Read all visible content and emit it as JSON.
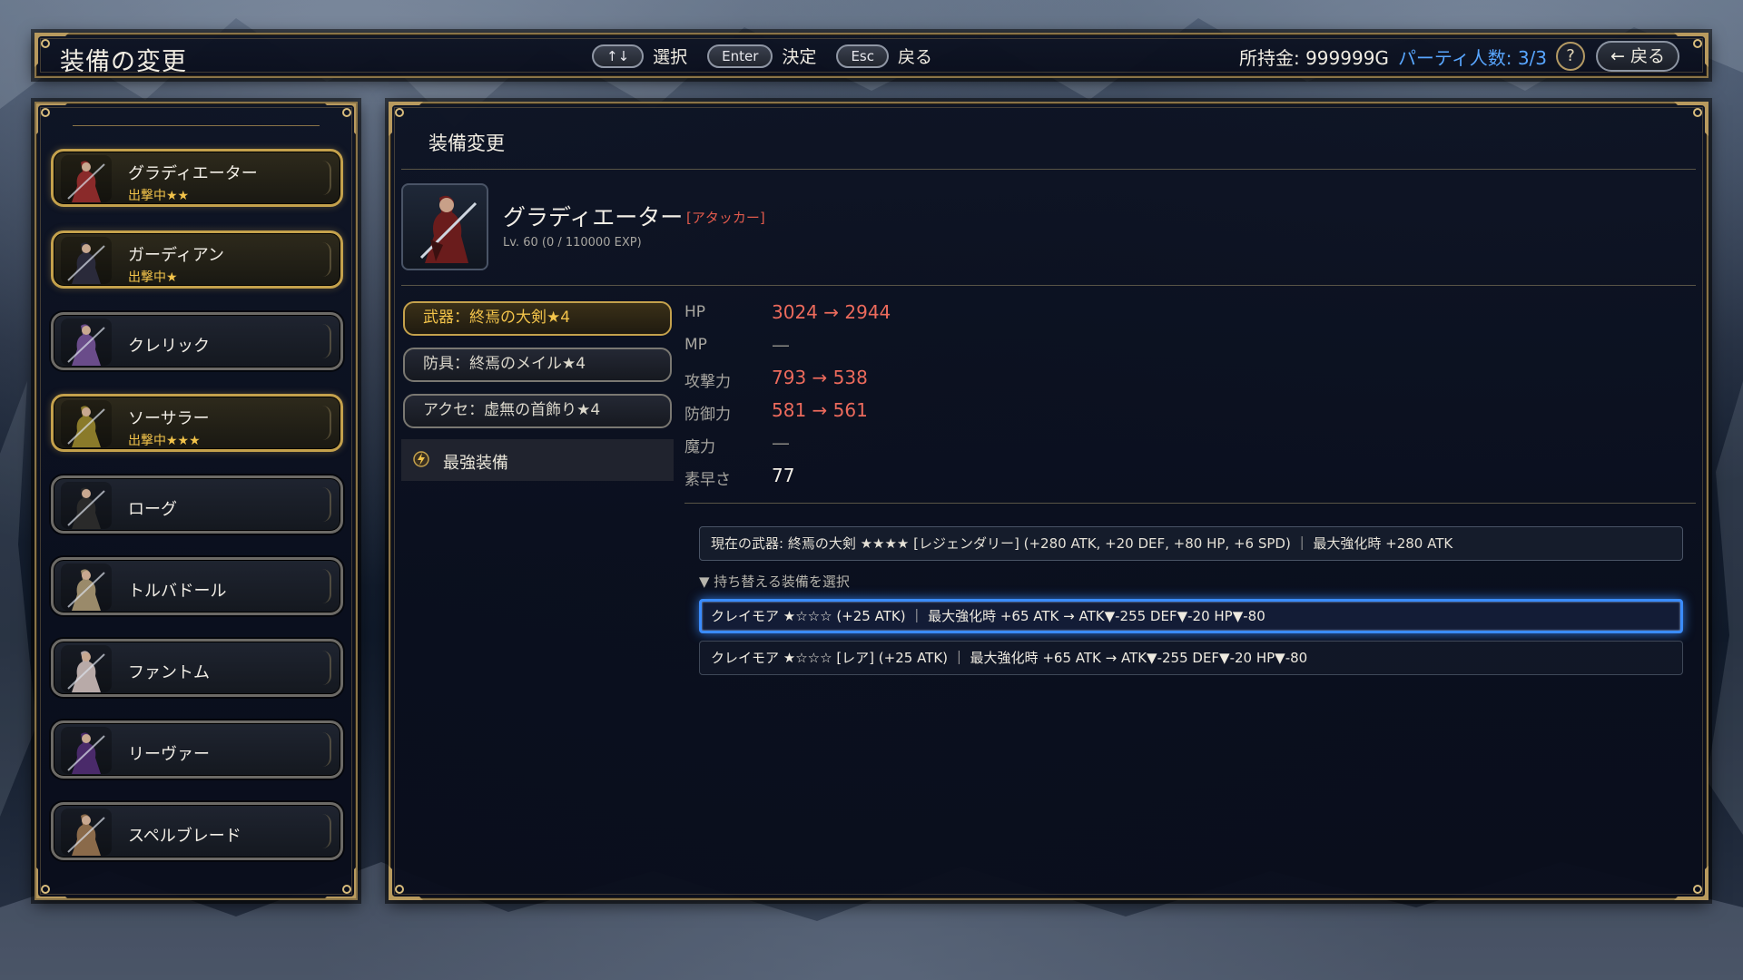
{
  "header": {
    "title": "装備の変更",
    "keys": [
      {
        "key": "↑↓",
        "label": "選択"
      },
      {
        "key": "Enter",
        "label": "決定"
      },
      {
        "key": "Esc",
        "label": "戻る"
      }
    ],
    "gold": "所持金: 999999G",
    "party": "パーティ人数: 3/3",
    "help": "?",
    "back": "← 戻る"
  },
  "roster": [
    {
      "name": "グラディエーター",
      "status": "出撃中★★",
      "deployed": true,
      "color": "#8a2a2a"
    },
    {
      "name": "ガーディアン",
      "status": "出撃中★",
      "deployed": true,
      "color": "#2a2a3a"
    },
    {
      "name": "クレリック",
      "status": "",
      "deployed": false,
      "color": "#6a4c8a"
    },
    {
      "name": "ソーサラー",
      "status": "出撃中★★★",
      "deployed": true,
      "color": "#8a7a2a"
    },
    {
      "name": "ローグ",
      "status": "",
      "deployed": false,
      "color": "#2a2a2a"
    },
    {
      "name": "トルバドール",
      "status": "",
      "deployed": false,
      "color": "#9a8a6a"
    },
    {
      "name": "ファントム",
      "status": "",
      "deployed": false,
      "color": "#b8aaa8"
    },
    {
      "name": "リーヴァー",
      "status": "",
      "deployed": false,
      "color": "#4a2a6a"
    },
    {
      "name": "スペルブレード",
      "status": "",
      "deployed": false,
      "color": "#8a6a4a"
    }
  ],
  "main": {
    "title": "装備変更",
    "character": {
      "name": "グラディエーター",
      "role": "[アタッカー]",
      "level": "Lv. 60  (0 / 110000 EXP)"
    },
    "slots": [
      {
        "label": "武器：終焉の大剣★4",
        "active": true
      },
      {
        "label": "防具：終焉のメイル★4",
        "active": false
      },
      {
        "label": "アクセ：虚無の首飾り★4",
        "active": false
      }
    ],
    "best_label": "最強装備",
    "stats": [
      {
        "label": "HP",
        "value": "3024 → 2944",
        "change": "down"
      },
      {
        "label": "MP",
        "value": "—",
        "change": "none"
      },
      {
        "label": "攻撃力",
        "value": "793 → 538",
        "change": "down"
      },
      {
        "label": "防御力",
        "value": "581 → 561",
        "change": "down"
      },
      {
        "label": "魔力",
        "value": "—",
        "change": "none"
      },
      {
        "label": "素早さ",
        "value": "77",
        "change": ""
      }
    ],
    "current_weapon": "現在の武器: 終焉の大剣 ★★★★ [レジェンダリー] (+280 ATK, +20 DEF, +80 HP, +6 SPD) ｜ 最大強化時 +280 ATK",
    "swap_heading": "▼ 持ち替える装備を選択",
    "options": [
      {
        "text": "クレイモア ★☆☆☆ (+25 ATK) ｜ 最大強化時 +65 ATK  → ATK▼-255 DEF▼-20 HP▼-80",
        "selected": true
      },
      {
        "text": "クレイモア ★☆☆☆ [レア] (+25 ATK) ｜ 最大強化時 +65 ATK  → ATK▼-255 DEF▼-20 HP▼-80",
        "selected": false
      }
    ]
  },
  "colors": {
    "accent_gold": "#c4a14c",
    "highlight_blue": "#3a8cff",
    "stat_down": "#ec6a5c",
    "party_blue": "#58a6ff"
  }
}
